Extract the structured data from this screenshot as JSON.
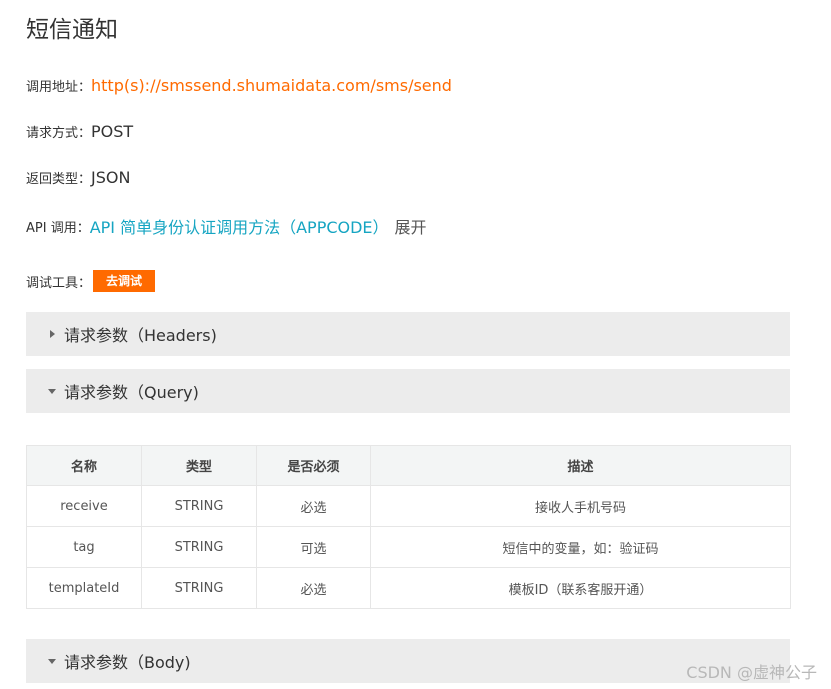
{
  "page": {
    "title": "短信通知"
  },
  "info": {
    "call_address_label": "调用地址：",
    "call_address_value": "http(s)://smssend.shumaidata.com/sms/send",
    "request_method_label": "请求方式：",
    "request_method_value": "POST",
    "return_type_label": "返回类型：",
    "return_type_value": "JSON",
    "api_call_label": "API 调用：",
    "api_call_link": "API 简单身份认证调用方法（APPCODE）",
    "api_call_expand": "展开",
    "debug_tool_label": "调试工具：",
    "debug_button": "去调试"
  },
  "sections": {
    "headers": {
      "title": "请求参数（Headers)",
      "expanded": false
    },
    "query": {
      "title": "请求参数（Query)",
      "expanded": true
    },
    "body": {
      "title": "请求参数（Body)",
      "expanded": true
    }
  },
  "query_table": {
    "columns": [
      "名称",
      "类型",
      "是否必须",
      "描述"
    ],
    "rows": [
      [
        "receive",
        "STRING",
        "必选",
        "接收人手机号码"
      ],
      [
        "tag",
        "STRING",
        "可选",
        "短信中的变量，如：验证码"
      ],
      [
        "templateId",
        "STRING",
        "必选",
        "模板ID（联系客服开通）"
      ]
    ]
  },
  "watermark": "CSDN @虚神公子",
  "colors": {
    "accent_orange": "#ff6a00",
    "link_blue": "#16a5c2",
    "section_bg": "#ececec"
  },
  "icons": {
    "collapsed": "caret-right-icon",
    "expanded": "caret-down-icon"
  }
}
